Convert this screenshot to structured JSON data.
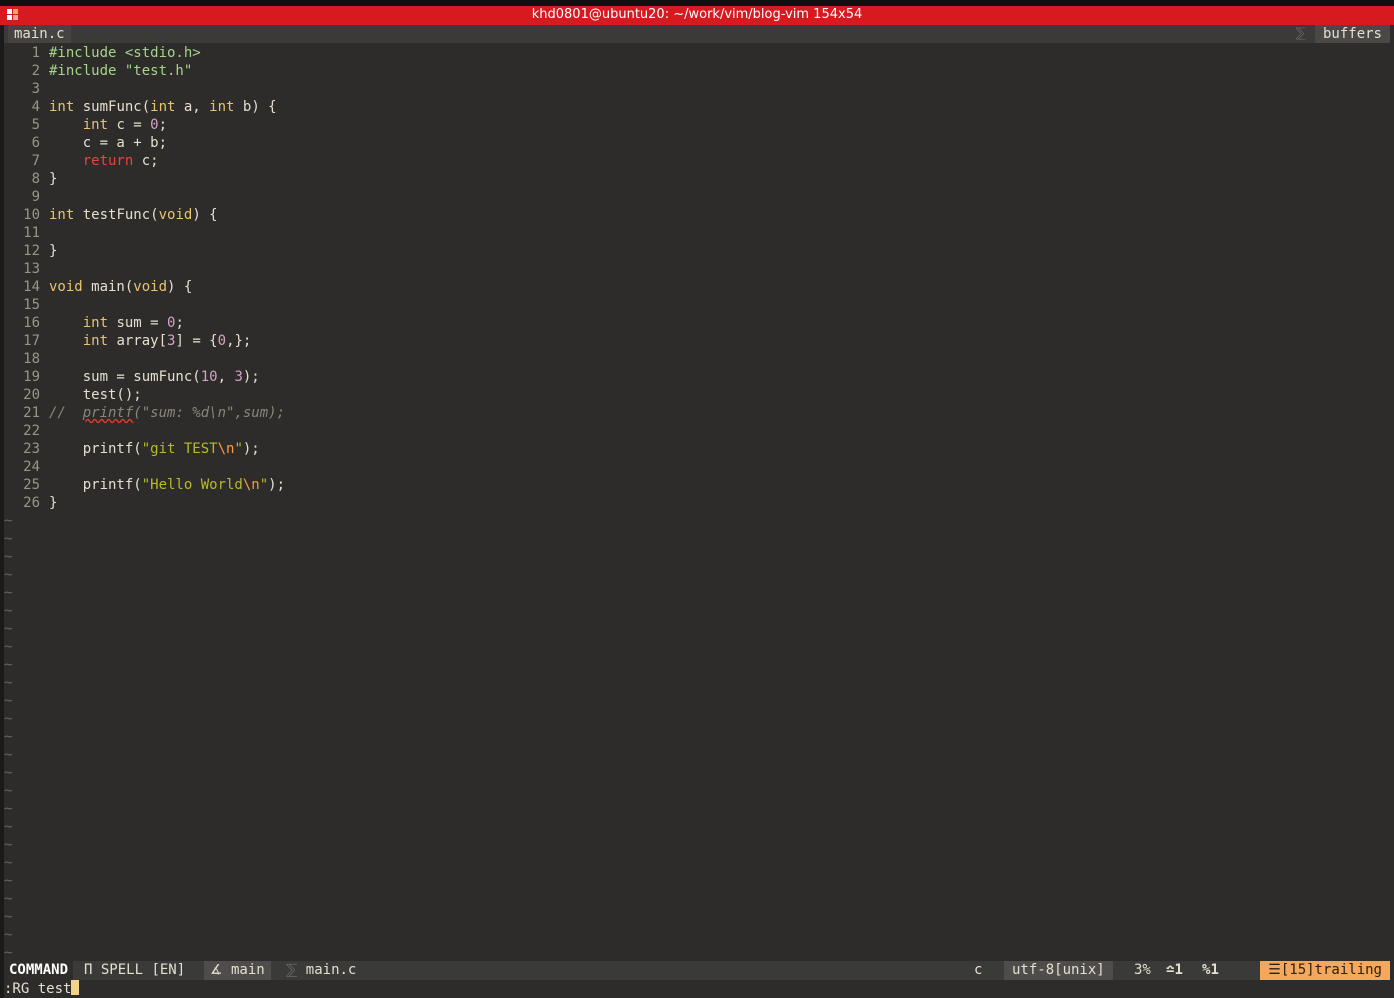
{
  "window": {
    "title": "khd0801@ubuntu20: ~/work/vim/blog-vim 154x54",
    "accent": "#d71920"
  },
  "tabline": {
    "active_tab": "main.c",
    "right_label": "buffers"
  },
  "editor": {
    "lines": [
      {
        "n": "1",
        "html": "<span class=\"pre\">#include &lt;stdio.h&gt;</span>"
      },
      {
        "n": "2",
        "html": "<span class=\"pre\">#include \"test.h\"</span>"
      },
      {
        "n": "3",
        "html": ""
      },
      {
        "n": "4",
        "html": "<span class=\"kw\">int</span> sumFunc(<span class=\"kw\">int</span> a, <span class=\"kw\">int</span> b) {"
      },
      {
        "n": "5",
        "html": "    <span class=\"kw\">int</span> c = <span class=\"num\">0</span>;"
      },
      {
        "n": "6",
        "html": "    c = a + b;"
      },
      {
        "n": "7",
        "html": "    <span class=\"ret\">return</span> c;"
      },
      {
        "n": "8",
        "html": "}"
      },
      {
        "n": "9",
        "html": ""
      },
      {
        "n": "10",
        "html": "<span class=\"kw\">int</span> testFunc(<span class=\"kw\">void</span>) {"
      },
      {
        "n": "11",
        "html": ""
      },
      {
        "n": "12",
        "html": "}"
      },
      {
        "n": "13",
        "html": ""
      },
      {
        "n": "14",
        "html": "<span class=\"kw\">void</span> main(<span class=\"kw\">void</span>) {"
      },
      {
        "n": "15",
        "html": ""
      },
      {
        "n": "16",
        "html": "    <span class=\"kw\">int</span> sum = <span class=\"num\">0</span>;"
      },
      {
        "n": "17",
        "html": "    <span class=\"kw\">int</span> array[<span class=\"num\">3</span>] = {<span class=\"num\">0</span>,};"
      },
      {
        "n": "18",
        "html": ""
      },
      {
        "n": "19",
        "html": "    sum = sumFunc(<span class=\"num\">10</span>, <span class=\"num\">3</span>);"
      },
      {
        "n": "20",
        "html": "    test();"
      },
      {
        "n": "21",
        "html": "<span class=\"cmt\">//  <span class=\"spell\">printf</span>(\"sum: %d\\n\",sum);</span>"
      },
      {
        "n": "22",
        "html": ""
      },
      {
        "n": "23",
        "html": "    printf(<span class=\"str\">\"git TEST</span><span class=\"esc\">\\n</span><span class=\"str\">\"</span>);"
      },
      {
        "n": "24",
        "html": ""
      },
      {
        "n": "25",
        "html": "    printf(<span class=\"str\">\"Hello World</span><span class=\"esc\">\\n</span><span class=\"str\">\"</span>);"
      },
      {
        "n": "26",
        "html": "}"
      }
    ],
    "tilde_char": "~"
  },
  "statusline": {
    "mode": "COMMAND",
    "spell_icon": "Π",
    "spell": "SPELL [EN]",
    "branch_icon": "∡",
    "branch": "main",
    "filename": "main.c",
    "filetype": "c",
    "encoding": "utf-8[unix]",
    "percent": "3%",
    "line_icon": "␤",
    "line": "1",
    "col_icon": "%",
    "col": "1",
    "warn_icon": "☰",
    "trailing": "[15]trailing",
    "warn_color": "#f6a85a"
  },
  "cmdline": {
    "text": ":RG test"
  }
}
